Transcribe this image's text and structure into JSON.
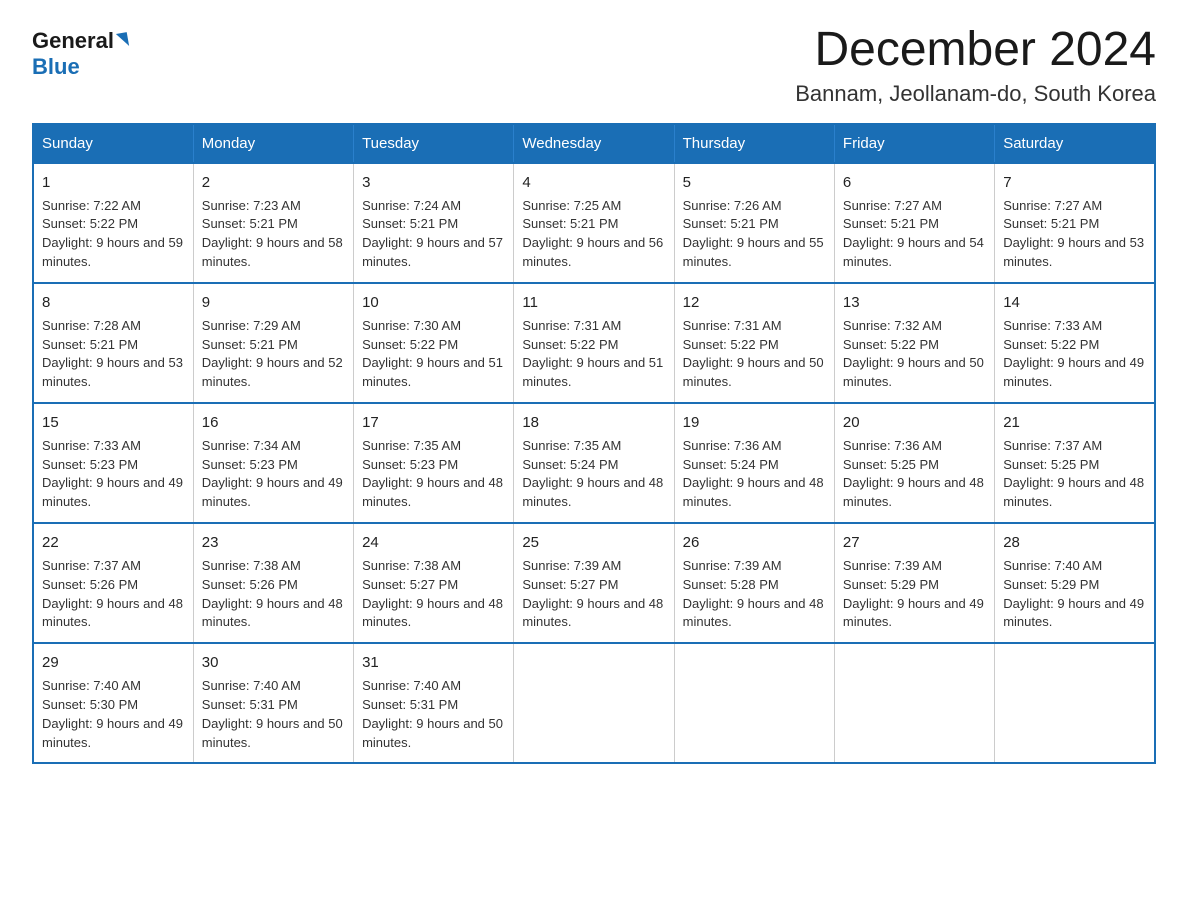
{
  "logo": {
    "general": "General",
    "blue": "Blue"
  },
  "title": "December 2024",
  "location": "Bannam, Jeollanam-do, South Korea",
  "headers": [
    "Sunday",
    "Monday",
    "Tuesday",
    "Wednesday",
    "Thursday",
    "Friday",
    "Saturday"
  ],
  "weeks": [
    [
      {
        "day": "1",
        "sunrise": "Sunrise: 7:22 AM",
        "sunset": "Sunset: 5:22 PM",
        "daylight": "Daylight: 9 hours and 59 minutes."
      },
      {
        "day": "2",
        "sunrise": "Sunrise: 7:23 AM",
        "sunset": "Sunset: 5:21 PM",
        "daylight": "Daylight: 9 hours and 58 minutes."
      },
      {
        "day": "3",
        "sunrise": "Sunrise: 7:24 AM",
        "sunset": "Sunset: 5:21 PM",
        "daylight": "Daylight: 9 hours and 57 minutes."
      },
      {
        "day": "4",
        "sunrise": "Sunrise: 7:25 AM",
        "sunset": "Sunset: 5:21 PM",
        "daylight": "Daylight: 9 hours and 56 minutes."
      },
      {
        "day": "5",
        "sunrise": "Sunrise: 7:26 AM",
        "sunset": "Sunset: 5:21 PM",
        "daylight": "Daylight: 9 hours and 55 minutes."
      },
      {
        "day": "6",
        "sunrise": "Sunrise: 7:27 AM",
        "sunset": "Sunset: 5:21 PM",
        "daylight": "Daylight: 9 hours and 54 minutes."
      },
      {
        "day": "7",
        "sunrise": "Sunrise: 7:27 AM",
        "sunset": "Sunset: 5:21 PM",
        "daylight": "Daylight: 9 hours and 53 minutes."
      }
    ],
    [
      {
        "day": "8",
        "sunrise": "Sunrise: 7:28 AM",
        "sunset": "Sunset: 5:21 PM",
        "daylight": "Daylight: 9 hours and 53 minutes."
      },
      {
        "day": "9",
        "sunrise": "Sunrise: 7:29 AM",
        "sunset": "Sunset: 5:21 PM",
        "daylight": "Daylight: 9 hours and 52 minutes."
      },
      {
        "day": "10",
        "sunrise": "Sunrise: 7:30 AM",
        "sunset": "Sunset: 5:22 PM",
        "daylight": "Daylight: 9 hours and 51 minutes."
      },
      {
        "day": "11",
        "sunrise": "Sunrise: 7:31 AM",
        "sunset": "Sunset: 5:22 PM",
        "daylight": "Daylight: 9 hours and 51 minutes."
      },
      {
        "day": "12",
        "sunrise": "Sunrise: 7:31 AM",
        "sunset": "Sunset: 5:22 PM",
        "daylight": "Daylight: 9 hours and 50 minutes."
      },
      {
        "day": "13",
        "sunrise": "Sunrise: 7:32 AM",
        "sunset": "Sunset: 5:22 PM",
        "daylight": "Daylight: 9 hours and 50 minutes."
      },
      {
        "day": "14",
        "sunrise": "Sunrise: 7:33 AM",
        "sunset": "Sunset: 5:22 PM",
        "daylight": "Daylight: 9 hours and 49 minutes."
      }
    ],
    [
      {
        "day": "15",
        "sunrise": "Sunrise: 7:33 AM",
        "sunset": "Sunset: 5:23 PM",
        "daylight": "Daylight: 9 hours and 49 minutes."
      },
      {
        "day": "16",
        "sunrise": "Sunrise: 7:34 AM",
        "sunset": "Sunset: 5:23 PM",
        "daylight": "Daylight: 9 hours and 49 minutes."
      },
      {
        "day": "17",
        "sunrise": "Sunrise: 7:35 AM",
        "sunset": "Sunset: 5:23 PM",
        "daylight": "Daylight: 9 hours and 48 minutes."
      },
      {
        "day": "18",
        "sunrise": "Sunrise: 7:35 AM",
        "sunset": "Sunset: 5:24 PM",
        "daylight": "Daylight: 9 hours and 48 minutes."
      },
      {
        "day": "19",
        "sunrise": "Sunrise: 7:36 AM",
        "sunset": "Sunset: 5:24 PM",
        "daylight": "Daylight: 9 hours and 48 minutes."
      },
      {
        "day": "20",
        "sunrise": "Sunrise: 7:36 AM",
        "sunset": "Sunset: 5:25 PM",
        "daylight": "Daylight: 9 hours and 48 minutes."
      },
      {
        "day": "21",
        "sunrise": "Sunrise: 7:37 AM",
        "sunset": "Sunset: 5:25 PM",
        "daylight": "Daylight: 9 hours and 48 minutes."
      }
    ],
    [
      {
        "day": "22",
        "sunrise": "Sunrise: 7:37 AM",
        "sunset": "Sunset: 5:26 PM",
        "daylight": "Daylight: 9 hours and 48 minutes."
      },
      {
        "day": "23",
        "sunrise": "Sunrise: 7:38 AM",
        "sunset": "Sunset: 5:26 PM",
        "daylight": "Daylight: 9 hours and 48 minutes."
      },
      {
        "day": "24",
        "sunrise": "Sunrise: 7:38 AM",
        "sunset": "Sunset: 5:27 PM",
        "daylight": "Daylight: 9 hours and 48 minutes."
      },
      {
        "day": "25",
        "sunrise": "Sunrise: 7:39 AM",
        "sunset": "Sunset: 5:27 PM",
        "daylight": "Daylight: 9 hours and 48 minutes."
      },
      {
        "day": "26",
        "sunrise": "Sunrise: 7:39 AM",
        "sunset": "Sunset: 5:28 PM",
        "daylight": "Daylight: 9 hours and 48 minutes."
      },
      {
        "day": "27",
        "sunrise": "Sunrise: 7:39 AM",
        "sunset": "Sunset: 5:29 PM",
        "daylight": "Daylight: 9 hours and 49 minutes."
      },
      {
        "day": "28",
        "sunrise": "Sunrise: 7:40 AM",
        "sunset": "Sunset: 5:29 PM",
        "daylight": "Daylight: 9 hours and 49 minutes."
      }
    ],
    [
      {
        "day": "29",
        "sunrise": "Sunrise: 7:40 AM",
        "sunset": "Sunset: 5:30 PM",
        "daylight": "Daylight: 9 hours and 49 minutes."
      },
      {
        "day": "30",
        "sunrise": "Sunrise: 7:40 AM",
        "sunset": "Sunset: 5:31 PM",
        "daylight": "Daylight: 9 hours and 50 minutes."
      },
      {
        "day": "31",
        "sunrise": "Sunrise: 7:40 AM",
        "sunset": "Sunset: 5:31 PM",
        "daylight": "Daylight: 9 hours and 50 minutes."
      },
      null,
      null,
      null,
      null
    ]
  ]
}
